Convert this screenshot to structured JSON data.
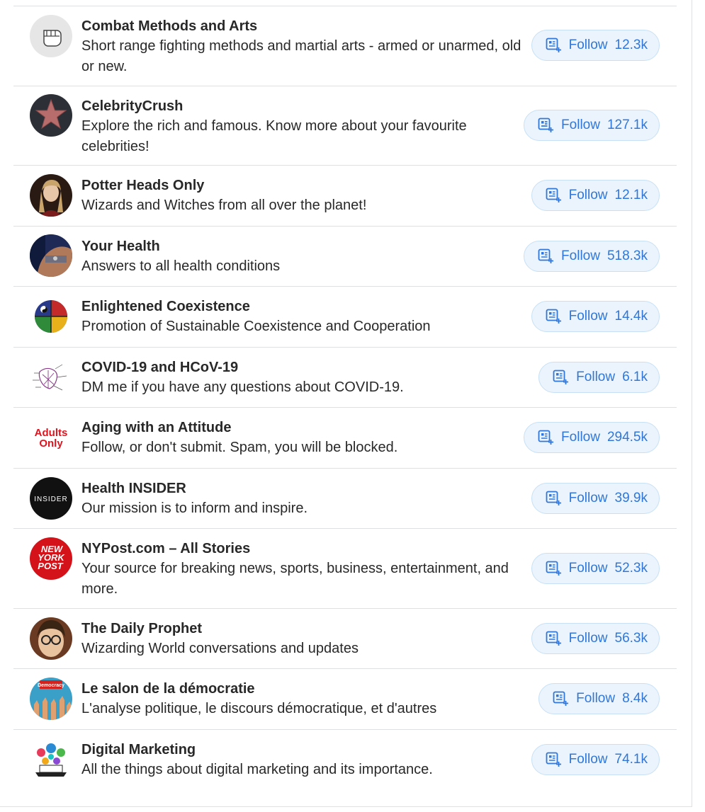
{
  "follow_label": "Follow",
  "avatars": {
    "adults_only_line1": "Adults",
    "adults_only_line2": "Only",
    "insider_logo": "INSIDER",
    "nypost_logo_line1": "NEW",
    "nypost_logo_line2": "YORK",
    "nypost_logo_line3": "POST",
    "democracy_sign": "Democracy"
  },
  "spaces": [
    {
      "title": "Combat Methods and Arts",
      "desc": "Short range fighting methods and martial arts - armed or unarmed, old or new.",
      "count": "12.3k"
    },
    {
      "title": "CelebrityCrush",
      "desc": "Explore the rich and famous. Know more about your favourite celebrities!",
      "count": "127.1k"
    },
    {
      "title": "Potter Heads Only",
      "desc": "Wizards and Witches from all over the planet!",
      "count": "12.1k"
    },
    {
      "title": "Your Health",
      "desc": "Answers to all health conditions",
      "count": "518.3k"
    },
    {
      "title": "Enlightened Coexistence",
      "desc": "Promotion of Sustainable Coexistence and Cooperation",
      "count": "14.4k"
    },
    {
      "title": "COVID-19 and HCoV-19",
      "desc": "DM me if you have any questions about COVID-19.",
      "count": "6.1k"
    },
    {
      "title": "Aging with an Attitude",
      "desc": "Follow, or don't submit. Spam, you will be blocked.",
      "count": "294.5k"
    },
    {
      "title": "Health INSIDER",
      "desc": "Our mission is to inform and inspire.",
      "count": "39.9k"
    },
    {
      "title": "NYPost.com – All Stories",
      "desc": "Your source for breaking news, sports, business, entertainment, and more.",
      "count": "52.3k"
    },
    {
      "title": "The Daily Prophet",
      "desc": "Wizarding World conversations and updates",
      "count": "56.3k"
    },
    {
      "title": "Le salon de la démocratie",
      "desc": "L'analyse politique, le discours démocratique, et d'autres",
      "count": "8.4k"
    },
    {
      "title": "Digital Marketing",
      "desc": "All the things about digital marketing and its importance.",
      "count": "74.1k"
    }
  ]
}
